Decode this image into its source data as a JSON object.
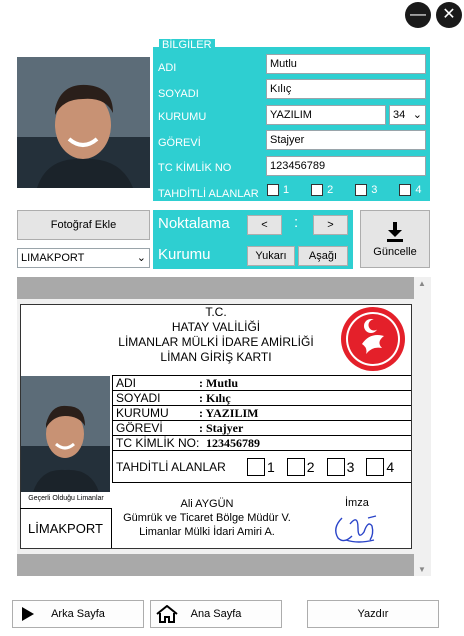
{
  "window": {
    "minimize_glyph": "—",
    "close_glyph": "✕"
  },
  "form": {
    "group_title": "BİLGİLER",
    "labels": {
      "adi": "ADI",
      "soyadi": "SOYADI",
      "kurumu": "KURUMU",
      "gorevi": "GÖREVİ",
      "tc": "TC KİMLİK NO",
      "tahditli": "TAHDİTLİ ALANLAR"
    },
    "values": {
      "adi": "Mutlu",
      "soyadi": "Kılıç",
      "kurumu": "YAZILIM",
      "kurumu_num": "34",
      "gorevi": "Stajyer",
      "tc": "123456789"
    },
    "checks": [
      "1",
      "2",
      "3",
      "4"
    ]
  },
  "controls": {
    "add_photo": "Fotoğraf Ekle",
    "location_select": "LIMAKPORT",
    "noktalama": "Noktalama",
    "left": "<",
    "colon": ":",
    "right": ">",
    "kurumu": "Kurumu",
    "up": "Yukarı",
    "down": "Aşağı",
    "update": "Güncelle"
  },
  "card": {
    "tc": "T.C.",
    "line1": "HATAY VALİLİĞİ",
    "line2": "LİMANLAR MÜLKİ İDARE AMİRLİĞİ",
    "line3": "LİMAN GİRİŞ KARTI",
    "emblem_text": "HATAY VALİLİĞİ",
    "labels": {
      "adi": "ADI",
      "soyadi": "SOYADI",
      "kurumu": "KURUMU",
      "gorevi": "GÖREVİ",
      "tc": "TC KİMLİK NO:",
      "tahditli": "TAHDİTLİ ALANLAR"
    },
    "values": {
      "adi": ": Mutlu",
      "soyadi": ": Kılıç",
      "kurumu": ": YAZILIM",
      "gorevi": ": Stajyer",
      "tc": "123456789"
    },
    "checks": [
      "1",
      "2",
      "3",
      "4"
    ],
    "validity": "Geçerli Olduğu Limanlar",
    "port": "LİMAKPORT",
    "signer_name": "Ali AYGÜN",
    "signer_title1": "Gümrük ve Ticaret Bölge Müdür V.",
    "signer_title2": "Limanlar Mülki İdari Amiri A.",
    "imza": "İmza"
  },
  "footer": {
    "back": "Arka Sayfa",
    "home": "Ana Sayfa",
    "print": "Yazdır"
  },
  "colors": {
    "panel": "#2ecfd1",
    "emblem": "#e4202a"
  }
}
